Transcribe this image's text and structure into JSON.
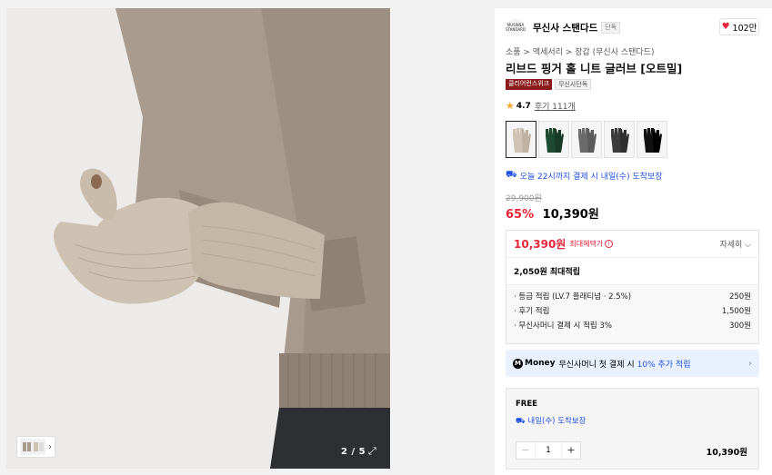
{
  "gallery": {
    "counter": "2 / 5",
    "expand_icon": "expand-icon"
  },
  "brand": {
    "logo_text": "MUSINSA STANDARD",
    "name": "무신사 스탠다드",
    "tag": "단독"
  },
  "like": {
    "icon": "heart-icon",
    "count": "102만"
  },
  "breadcrumb": "소품 > 액세서리 > 장갑 (무신사 스탠다드)",
  "product": {
    "title": "리브드 핑거 홀 니트 글러브 [오트밀]",
    "badge_1": "클리어런스위크",
    "badge_2": "무신사단독",
    "rating": "4.7",
    "reviews": "후기 111개",
    "swatches": [
      {
        "color": "#cfc3b4",
        "name": "oatmeal"
      },
      {
        "color": "#1f4a32",
        "name": "green"
      },
      {
        "color": "#6a6a6a",
        "name": "gray"
      },
      {
        "color": "#3c3c3c",
        "name": "charcoal"
      },
      {
        "color": "#111111",
        "name": "black"
      }
    ],
    "delivery": "오늘 22시까지 결제 시 내일(수) 도착보장",
    "original_price": "29,900원",
    "discount": "65%",
    "price": "10,390원"
  },
  "benefit": {
    "price": "10,390원",
    "label": "최대혜택가",
    "detail": "자세히 ⌵",
    "points_total": "2,050원 최대적립",
    "points": [
      {
        "label": "· 등급 적립 (LV.7 플래티넘 · 2.5%)",
        "value": "250원"
      },
      {
        "label": "· 후기 적립",
        "value": "1,500원"
      },
      {
        "label": "· 무신사머니 결제 시 적립 3%",
        "value": "300원"
      }
    ]
  },
  "money": {
    "logo": "M",
    "word": "Money",
    "text": "무신사머니 첫 결제 시",
    "highlight": "10% 추가 적립"
  },
  "order": {
    "shipping": "FREE",
    "delivery": "내일(수) 도착보장",
    "quantity": "1",
    "minus": "−",
    "plus": "+",
    "total": "10,390원"
  },
  "colors": {
    "accent_red": "#e6253a",
    "accent_blue": "#2050e0",
    "badge_red": "#8b1a1a"
  }
}
